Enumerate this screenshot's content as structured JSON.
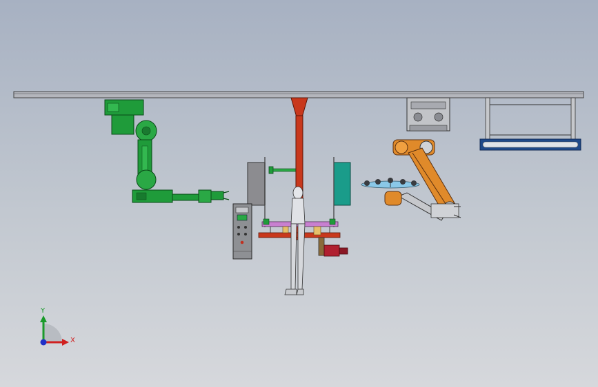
{
  "viewport": {
    "background_top": "#a7b1c2",
    "background_bottom": "#d6d8dc"
  },
  "triad": {
    "x_label": "X",
    "y_label": "Y",
    "x_color": "#d02020",
    "y_color": "#1a9a2a",
    "z_color": "#2030c8"
  },
  "colors": {
    "gantry_beam": "#b4b6bc",
    "green_robot": "#1f9b3a",
    "red_column": "#c8381c",
    "teal_panel": "#1a9c8a",
    "orange_robot": "#e08a2a",
    "control_cabinet": "#8e9094"
  }
}
